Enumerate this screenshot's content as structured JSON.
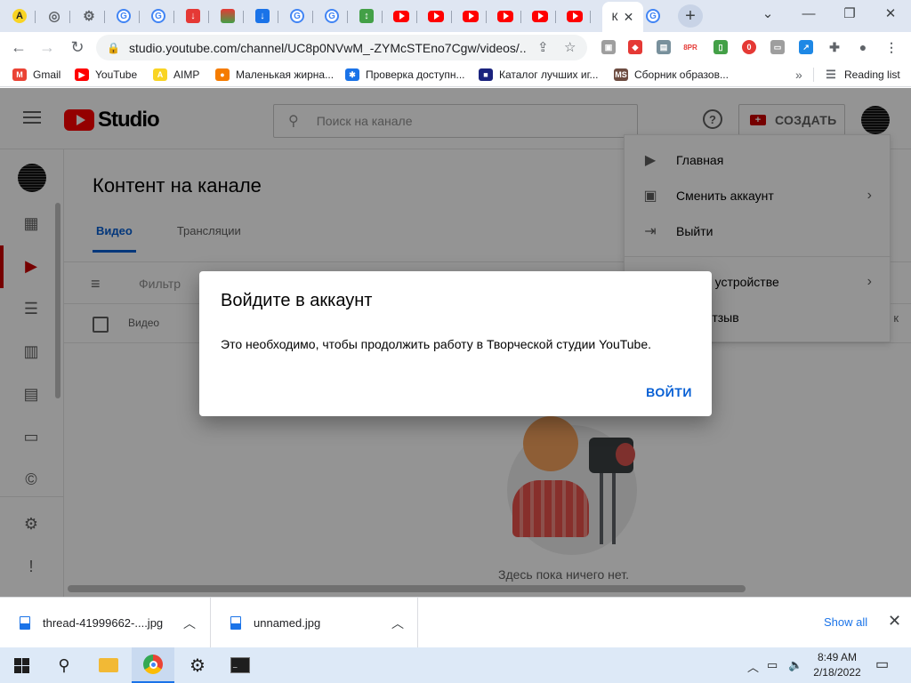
{
  "browser": {
    "tabs": [
      {
        "icon": "aimp-icon",
        "cls": "aimp",
        "glyph": "A"
      },
      {
        "icon": "chromium-icon",
        "cls": "gear",
        "glyph": "◎"
      },
      {
        "icon": "settings-gear-icon",
        "cls": "gear",
        "glyph": "⚙"
      },
      {
        "icon": "google-icon",
        "cls": "g",
        "glyph": "G"
      },
      {
        "icon": "google-icon",
        "cls": "g",
        "glyph": "G"
      },
      {
        "icon": "red-download-icon",
        "cls": "red",
        "glyph": "↓"
      },
      {
        "icon": "rainbow-icon",
        "cls": "rb",
        "glyph": ""
      },
      {
        "icon": "blue-download-icon",
        "cls": "dl",
        "glyph": "↓"
      },
      {
        "icon": "google-icon",
        "cls": "g",
        "glyph": "G"
      },
      {
        "icon": "google-icon",
        "cls": "g",
        "glyph": "G"
      },
      {
        "icon": "upload-arrows-icon",
        "cls": "up",
        "glyph": "↕"
      },
      {
        "icon": "youtube-icon",
        "cls": "yt",
        "glyph": ""
      },
      {
        "icon": "youtube-icon",
        "cls": "yt",
        "glyph": ""
      },
      {
        "icon": "youtube-icon",
        "cls": "yt",
        "glyph": ""
      },
      {
        "icon": "youtube-icon",
        "cls": "yt",
        "glyph": ""
      },
      {
        "icon": "youtube-icon",
        "cls": "yt",
        "glyph": ""
      },
      {
        "icon": "youtube-icon",
        "cls": "yt",
        "glyph": ""
      }
    ],
    "active_tab_label": "К",
    "url": "studio.youtube.com/channel/UC8p0NVwM_-ZYMcSTEno7Cgw/videos/...",
    "bookmarks": [
      {
        "label": "Gmail",
        "icon": "gmail-icon",
        "color": "#ea4335",
        "glyph": "M"
      },
      {
        "label": "YouTube",
        "icon": "youtube-icon",
        "color": "#ff0000",
        "glyph": "▶"
      },
      {
        "label": "AIMP",
        "icon": "aimp-icon",
        "color": "#f9d423",
        "glyph": "A"
      },
      {
        "label": "Маленькая жирна...",
        "icon": "flame-icon",
        "color": "#f57c00",
        "glyph": "●"
      },
      {
        "label": "Проверка доступн...",
        "icon": "gear-globe-icon",
        "color": "#1a73e8",
        "glyph": "✱"
      },
      {
        "label": "Каталог лучших иг...",
        "icon": "catalog-icon",
        "color": "#1a237e",
        "glyph": "■"
      },
      {
        "label": "Сборник образов...",
        "icon": "ms-icon",
        "color": "#6d4c41",
        "glyph": "MS"
      }
    ],
    "bookmarks_overflow": "»",
    "reading_list": "Reading list"
  },
  "studio": {
    "logo_text": "Studio",
    "search_placeholder": "Поиск на канале",
    "create_label": "СОЗДАТЬ",
    "help_glyph": "?",
    "page_title": "Контент на канале",
    "tabs": [
      {
        "label": "Видео",
        "active": true
      },
      {
        "label": "Трансляции",
        "active": false
      }
    ],
    "filter_label": "Фильтр",
    "column_video": "Видео",
    "empty_text": "Здесь пока ничего нет.",
    "account_menu": [
      {
        "label": "Главная",
        "icon": "youtube-icon",
        "glyph": "▶",
        "chevron": false
      },
      {
        "label": "Сменить аккаунт",
        "icon": "switch-account-icon",
        "glyph": "👤",
        "chevron": true
      },
      {
        "label": "Выйти",
        "icon": "sign-out-icon",
        "glyph": "⇥",
        "chevron": false
      },
      {
        "label": "как на устройстве",
        "icon": "",
        "glyph": "",
        "chevron": true
      },
      {
        "label": "вить отзыв",
        "icon": "",
        "glyph": "",
        "chevron": false
      }
    ],
    "account_menu_overflow": "к"
  },
  "dialog": {
    "title": "Войдите в аккаунт",
    "text": "Это необходимо, чтобы продолжить работу в Творческой студии YouTube.",
    "button": "ВОЙТИ"
  },
  "downloads": {
    "items": [
      {
        "name": "thread-41999662-....jpg"
      },
      {
        "name": "unnamed.jpg"
      }
    ],
    "show_all": "Show all"
  },
  "taskbar": {
    "time": "8:49 AM",
    "date": "2/18/2022"
  },
  "colors": {
    "youtube_red": "#ff0000",
    "link_blue": "#065fd4",
    "tabstrip": "#dfe6f2"
  }
}
